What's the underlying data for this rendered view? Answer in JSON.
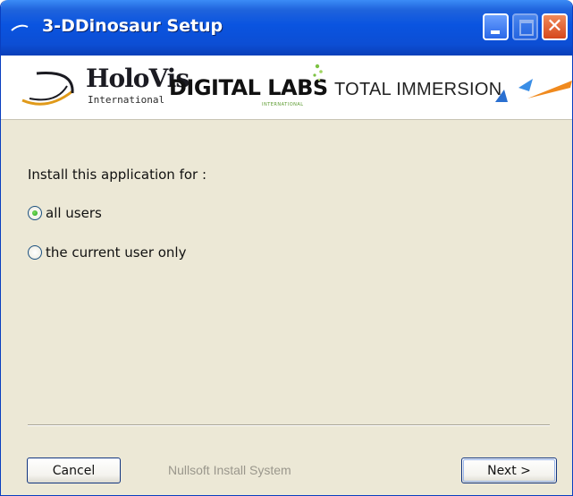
{
  "window": {
    "title": "3-DDinosaur Setup",
    "icon": "setup-app-icon",
    "controls": {
      "minimize_icon": "minimize-icon",
      "maximize_icon": "maximize-icon",
      "close_icon": "close-icon",
      "close_glyph": "✕"
    }
  },
  "banner": {
    "logos": {
      "holovis": {
        "name": "HoloVis",
        "sub": "International"
      },
      "digital_labs": {
        "name": "DIGITAL LABS",
        "sub": "INTERNATIONAL"
      },
      "total_immersion": {
        "name": "TOTAL IMMERSION"
      }
    }
  },
  "content": {
    "prompt": "Install this application for :",
    "options": [
      {
        "label": "all users",
        "selected": true
      },
      {
        "label": "the current user only",
        "selected": false
      }
    ]
  },
  "footer": {
    "cancel_label": "Cancel",
    "branding": "Nullsoft Install System",
    "next_label": "Next >"
  },
  "colors": {
    "titlebar": "#0a54e0",
    "dialog_bg": "#ece8d6",
    "radio_selected": "#21a121",
    "close_button": "#d6471c"
  }
}
